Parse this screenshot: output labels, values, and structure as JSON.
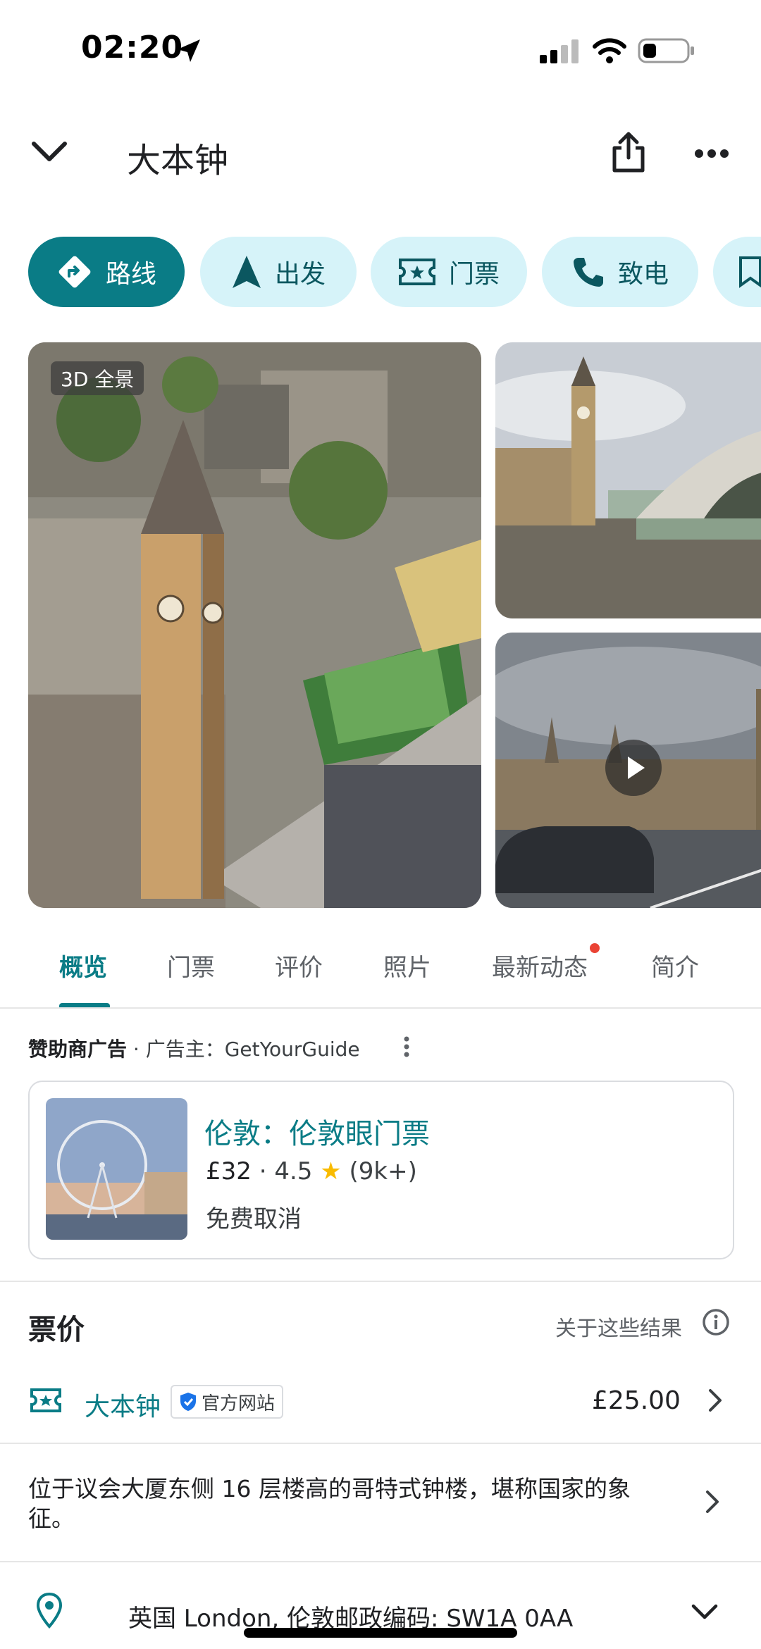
{
  "status_bar": {
    "time": "02:20"
  },
  "header": {
    "title": "大本钟"
  },
  "actions": [
    {
      "label": "路线",
      "icon": "directions-icon"
    },
    {
      "label": "出发",
      "icon": "navigation-arrow-icon"
    },
    {
      "label": "门票",
      "icon": "ticket-icon"
    },
    {
      "label": "致电",
      "icon": "phone-icon"
    }
  ],
  "photos": {
    "badge": "3D 全景"
  },
  "tabs": [
    "概览",
    "门票",
    "评价",
    "照片",
    "最新动态",
    "简介"
  ],
  "sponsored": {
    "label": "赞助商广告",
    "advertiser": "· 广告主：GetYourGuide",
    "title": "伦敦：伦敦眼门票",
    "price": "£32",
    "rating": "4.5",
    "reviews": "(9k+)",
    "cancel": "免费取消"
  },
  "prices": {
    "title": "票价",
    "about": "关于这些结果",
    "ticket_name": "大本钟",
    "official": "官方网站",
    "price": "£25.00"
  },
  "description": "位于议会大厦东侧 16 层楼高的哥特式钟楼，堪称国家的象征。",
  "address": "英国 London, 伦敦邮政编码: SW1A 0AA",
  "colors": {
    "accent": "#0a7c86",
    "chip_bg": "#d6f3f9"
  }
}
